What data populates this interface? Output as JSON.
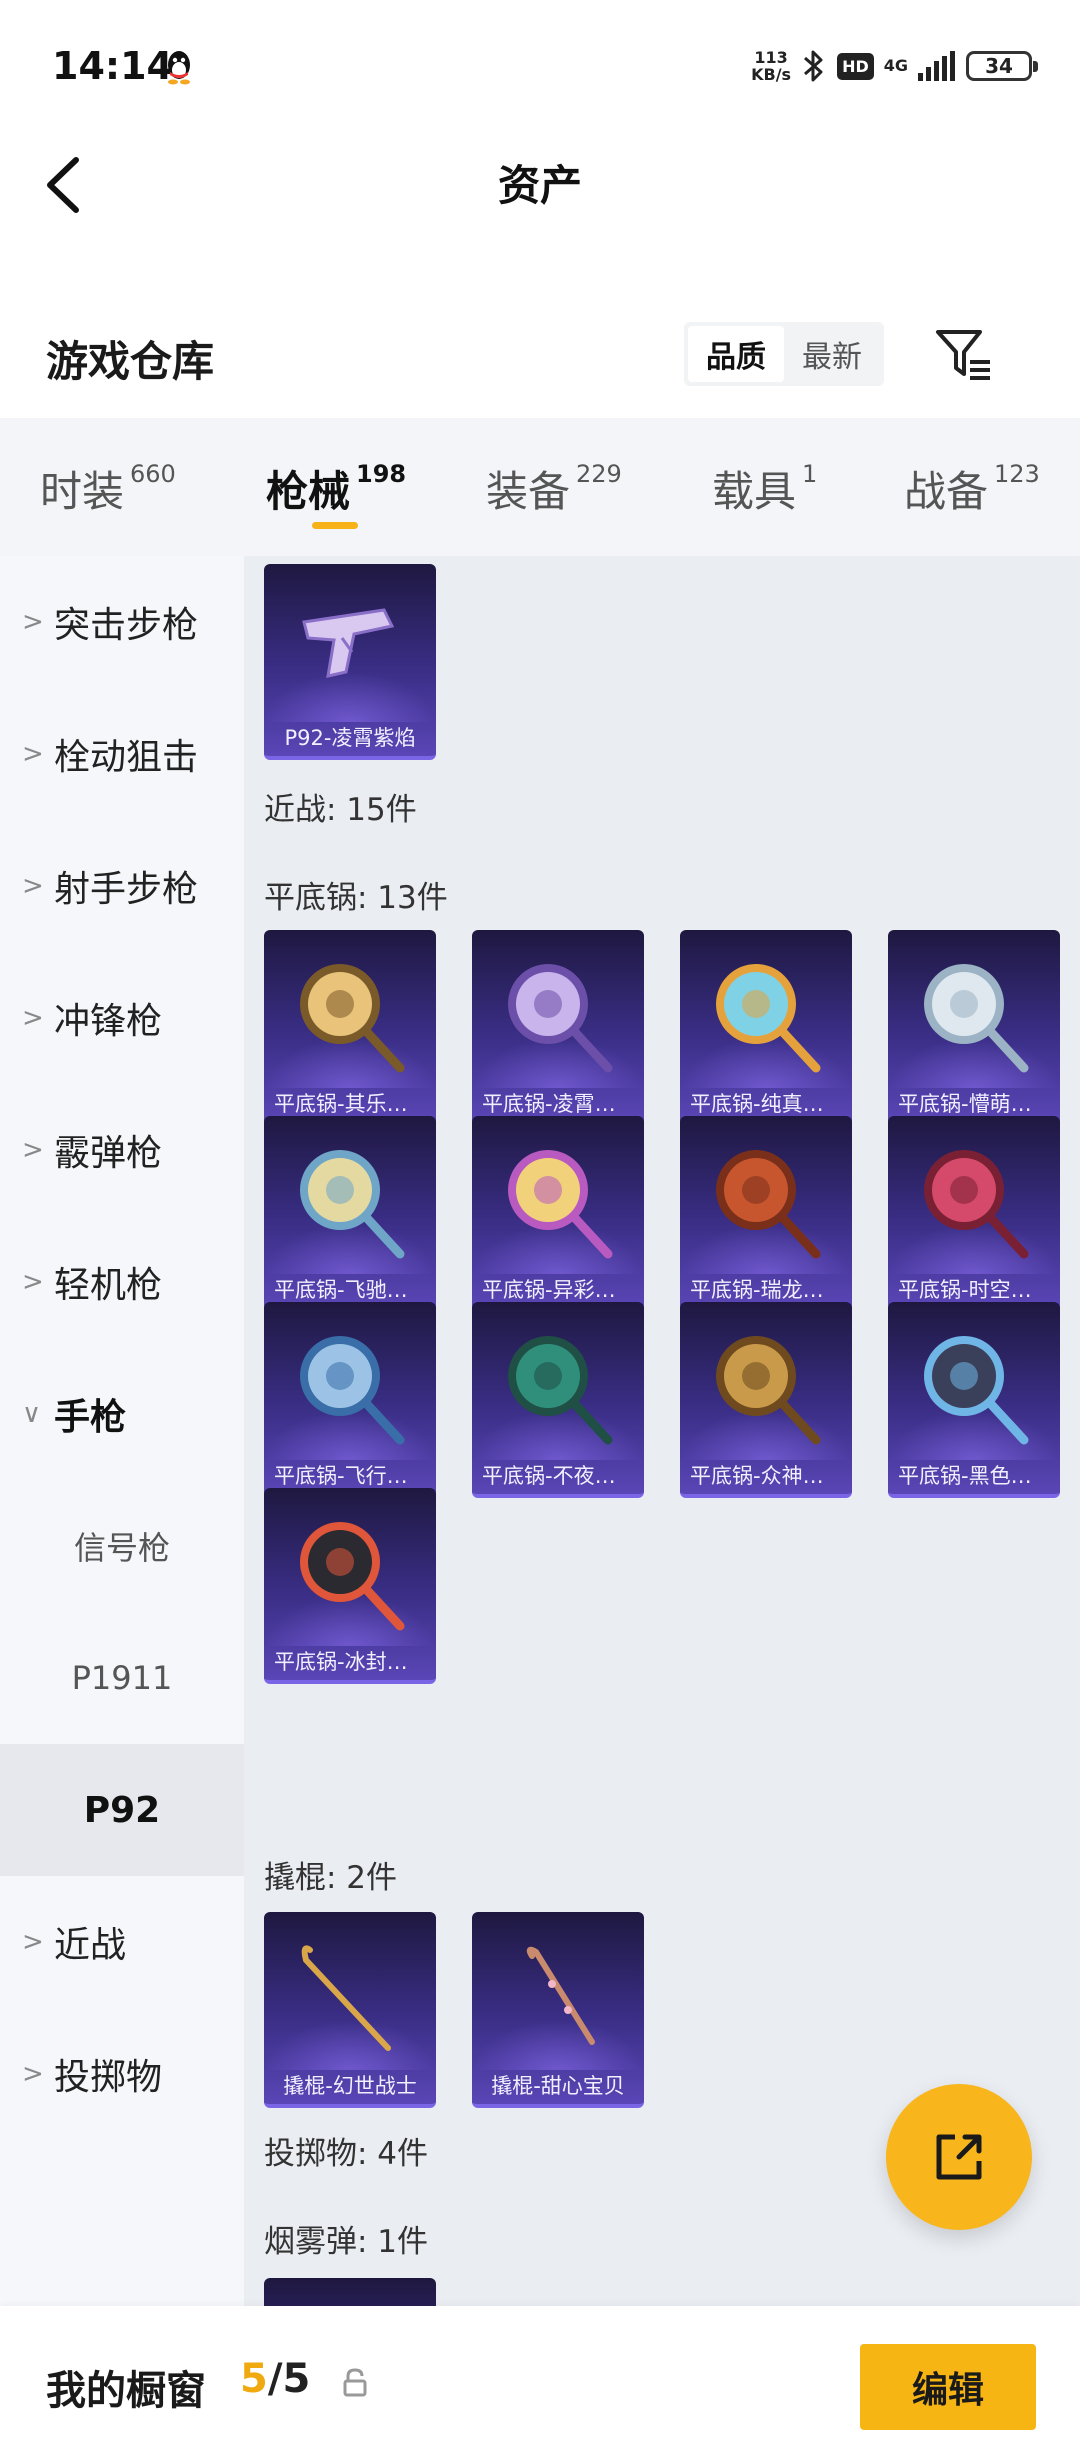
{
  "status_bar": {
    "time": "14:14",
    "speed_value": "113",
    "speed_unit": "KB/s",
    "hd": "HD",
    "network": "4G",
    "battery": "34"
  },
  "nav": {
    "title": "资产"
  },
  "section": {
    "title": "游戏仓库",
    "sort_quality": "品质",
    "sort_latest": "最新"
  },
  "tabs": [
    {
      "label": "时装",
      "count": "660"
    },
    {
      "label": "枪械",
      "count": "198"
    },
    {
      "label": "装备",
      "count": "229"
    },
    {
      "label": "载具",
      "count": "1"
    },
    {
      "label": "战备",
      "count": "123"
    }
  ],
  "sidebar": {
    "items": [
      {
        "label": "突击步枪",
        "chevron": ">"
      },
      {
        "label": "栓动狙击",
        "chevron": ">"
      },
      {
        "label": "射手步枪",
        "chevron": ">"
      },
      {
        "label": "冲锋枪",
        "chevron": ">"
      },
      {
        "label": "霰弹枪",
        "chevron": ">"
      },
      {
        "label": "轻机枪",
        "chevron": ">"
      },
      {
        "label": "手枪",
        "chevron": "∨"
      },
      {
        "label": "近战",
        "chevron": ">"
      },
      {
        "label": "投掷物",
        "chevron": ">"
      }
    ],
    "subitems": [
      {
        "label": "信号枪"
      },
      {
        "label": "P1911"
      },
      {
        "label": "P92"
      }
    ]
  },
  "content": {
    "top_item": "P92-凌霄紫焰",
    "melee_heading": "近战: 15件",
    "pan_heading": "平底锅: 13件",
    "pans": [
      "平底锅-其乐融融",
      "平底锅-凌霄紫焰",
      "平底锅-纯真年代",
      "平底锅-懵萌可爱",
      "平底锅-飞驰流光",
      "平底锅-异彩纷呈",
      "平底锅-瑞龙呈祥",
      "平底锅-时空之门",
      "平底锅-飞行日记",
      "平底锅-不夜之城",
      "平底锅-众神之战",
      "平底锅-黑色风暴",
      "平底锅-冰封炎魂"
    ],
    "crowbar_heading": "撬棍: 2件",
    "crowbars": [
      "撬棍-幻世战士",
      "撬棍-甜心宝贝"
    ],
    "throwable_heading": "投掷物: 4件",
    "smoke_heading": "烟雾弹: 1件"
  },
  "bottom": {
    "title": "我的橱窗",
    "count_current": "5",
    "count_total": "/5",
    "edit_label": "编辑"
  },
  "colors": {
    "accent": "#f7b513",
    "card_top": "#1e1840",
    "card_bottom": "#5a46b6"
  }
}
